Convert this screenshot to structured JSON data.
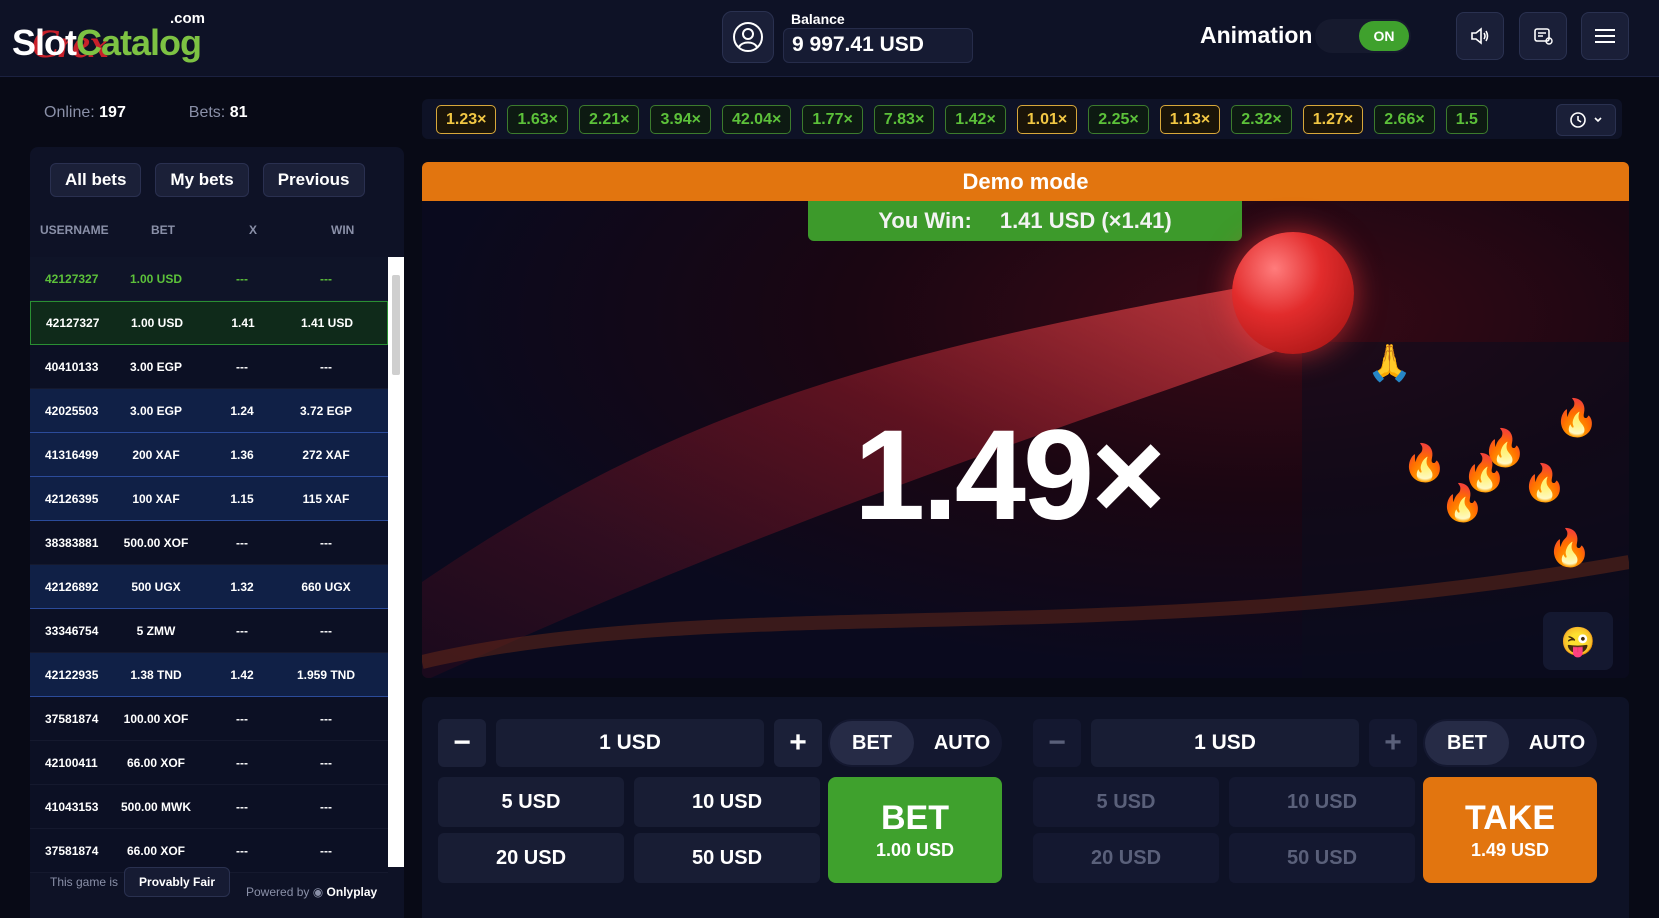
{
  "header": {
    "logo": {
      "slot": "Slot",
      "catalog": "Catalog",
      "com": ".com",
      "crex": "Crex"
    },
    "balance_label": "Balance",
    "balance_value": "9 997.41 USD",
    "animation_label": "Animation",
    "animation_state": "ON"
  },
  "stats": {
    "online_label": "Online:",
    "online_value": "197",
    "bets_label": "Bets:",
    "bets_value": "81"
  },
  "bets_panel": {
    "tabs": [
      "All bets",
      "My bets",
      "Previous"
    ],
    "columns": {
      "username": "USERNAME",
      "bet": "BET",
      "x": "X",
      "win": "WIN"
    },
    "rows": [
      {
        "user": "42127327",
        "bet": "1.00 USD",
        "x": "---",
        "win": "---",
        "style": "green-txt"
      },
      {
        "user": "42127327",
        "bet": "1.00 USD",
        "x": "1.41",
        "win": "1.41 USD",
        "style": "win"
      },
      {
        "user": "40410133",
        "bet": "3.00 EGP",
        "x": "---",
        "win": "---",
        "style": "dark"
      },
      {
        "user": "42025503",
        "bet": "3.00 EGP",
        "x": "1.24",
        "win": "3.72 EGP",
        "style": "blue"
      },
      {
        "user": "41316499",
        "bet": "200 XAF",
        "x": "1.36",
        "win": "272 XAF",
        "style": "blue"
      },
      {
        "user": "42126395",
        "bet": "100 XAF",
        "x": "1.15",
        "win": "115 XAF",
        "style": "blue"
      },
      {
        "user": "38383881",
        "bet": "500.00 XOF",
        "x": "---",
        "win": "---",
        "style": "dark"
      },
      {
        "user": "42126892",
        "bet": "500 UGX",
        "x": "1.32",
        "win": "660 UGX",
        "style": "blue"
      },
      {
        "user": "33346754",
        "bet": "5 ZMW",
        "x": "---",
        "win": "---",
        "style": "dark"
      },
      {
        "user": "42122935",
        "bet": "1.38 TND",
        "x": "1.42",
        "win": "1.959 TND",
        "style": "blue"
      },
      {
        "user": "37581874",
        "bet": "100.00 XOF",
        "x": "---",
        "win": "---",
        "style": "dark"
      },
      {
        "user": "42100411",
        "bet": "66.00 XOF",
        "x": "---",
        "win": "---",
        "style": "dark"
      },
      {
        "user": "41043153",
        "bet": "500.00 MWK",
        "x": "---",
        "win": "---",
        "style": "dark"
      },
      {
        "user": "37581874",
        "bet": "66.00 XOF",
        "x": "---",
        "win": "---",
        "style": "dark"
      }
    ],
    "footer_text": "This game is",
    "provably_fair": "Provably Fair",
    "powered_by": "Powered by",
    "provider": "Onlyplay"
  },
  "history": [
    {
      "v": "1.23×",
      "c": "y"
    },
    {
      "v": "1.63×",
      "c": "g"
    },
    {
      "v": "2.21×",
      "c": "g"
    },
    {
      "v": "3.94×",
      "c": "g"
    },
    {
      "v": "42.04×",
      "c": "g"
    },
    {
      "v": "1.77×",
      "c": "g"
    },
    {
      "v": "7.83×",
      "c": "g"
    },
    {
      "v": "1.42×",
      "c": "g"
    },
    {
      "v": "1.01×",
      "c": "y"
    },
    {
      "v": "2.25×",
      "c": "g"
    },
    {
      "v": "1.13×",
      "c": "y"
    },
    {
      "v": "2.32×",
      "c": "g"
    },
    {
      "v": "1.27×",
      "c": "y"
    },
    {
      "v": "2.66×",
      "c": "g"
    },
    {
      "v": "1.5",
      "c": "g"
    }
  ],
  "game": {
    "demo_label": "Demo mode",
    "win_label": "You Win:",
    "win_value": "1.41 USD (×1.41)",
    "multiplier": "1.49×",
    "emoji_button": "😜"
  },
  "panel1": {
    "amount": "1 USD",
    "bet": "BET",
    "auto": "AUTO",
    "quick": [
      "5 USD",
      "10 USD",
      "20 USD",
      "50 USD"
    ],
    "action_title": "BET",
    "action_sub": "1.00 USD"
  },
  "panel2": {
    "amount": "1 USD",
    "bet": "BET",
    "auto": "AUTO",
    "quick": [
      "5 USD",
      "10 USD",
      "20 USD",
      "50 USD"
    ],
    "action_title": "TAKE",
    "action_sub": "1.49 USD"
  },
  "colors": {
    "accent_green": "#3fa12d",
    "accent_orange": "#e2750f",
    "bg": "#080a16"
  }
}
